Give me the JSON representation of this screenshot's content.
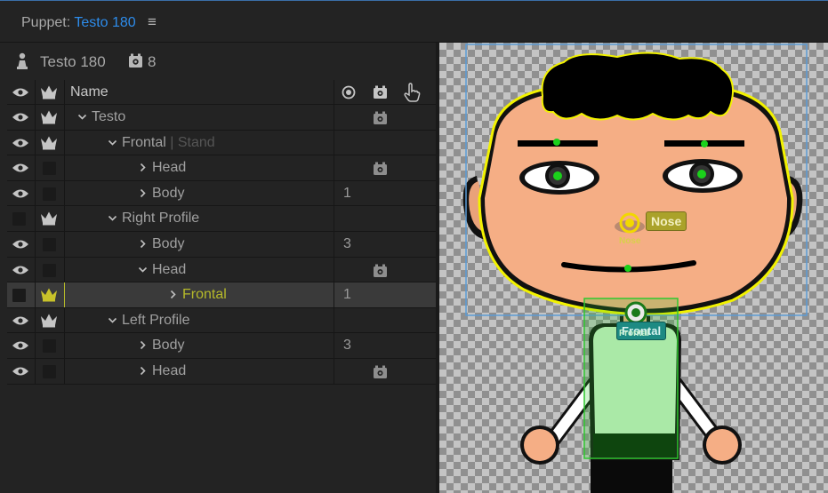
{
  "header": {
    "label": "Puppet:",
    "puppet_name": "Testo 180",
    "menu_glyph": "≡"
  },
  "puppet": {
    "name": "Testo 180",
    "behavior_count": "8"
  },
  "tree": {
    "column_name": "Name",
    "rows": [
      {
        "name": "Testo",
        "sub": "",
        "value": "",
        "eye": true,
        "crown": true,
        "behavior": true,
        "chevron": "down",
        "indent": 0,
        "selected": false
      },
      {
        "name": "Frontal",
        "sub": " | Stand",
        "value": "",
        "eye": true,
        "crown": true,
        "behavior": false,
        "chevron": "down",
        "indent": 1,
        "selected": false
      },
      {
        "name": "Head",
        "sub": "",
        "value": "",
        "eye": true,
        "crown": false,
        "behavior": true,
        "chevron": "right",
        "indent": 2,
        "selected": false
      },
      {
        "name": "Body",
        "sub": "",
        "value": "1",
        "eye": true,
        "crown": false,
        "behavior": false,
        "chevron": "right",
        "indent": 2,
        "selected": false
      },
      {
        "name": "Right Profile",
        "sub": "",
        "value": "",
        "eye": false,
        "crown": true,
        "behavior": false,
        "chevron": "down",
        "indent": 1,
        "selected": false
      },
      {
        "name": "Body",
        "sub": "",
        "value": "3",
        "eye": true,
        "crown": false,
        "behavior": false,
        "chevron": "right",
        "indent": 2,
        "selected": false
      },
      {
        "name": "Head",
        "sub": "",
        "value": "",
        "eye": true,
        "crown": false,
        "behavior": true,
        "chevron": "down",
        "indent": 2,
        "selected": false
      },
      {
        "name": "Frontal",
        "sub": "",
        "value": "1",
        "eye": false,
        "crown": true,
        "behavior": false,
        "chevron": "right",
        "indent": 3,
        "selected": true
      },
      {
        "name": "Left Profile",
        "sub": "",
        "value": "",
        "eye": true,
        "crown": true,
        "behavior": false,
        "chevron": "down",
        "indent": 1,
        "selected": false
      },
      {
        "name": "Body",
        "sub": "",
        "value": "3",
        "eye": true,
        "crown": false,
        "behavior": false,
        "chevron": "right",
        "indent": 2,
        "selected": false
      },
      {
        "name": "Head",
        "sub": "",
        "value": "",
        "eye": true,
        "crown": false,
        "behavior": true,
        "chevron": "right",
        "indent": 2,
        "selected": false
      }
    ]
  },
  "canvas": {
    "nose_tag": "Nose",
    "nose_sub": "Nose",
    "frontal_tag": "Frontal",
    "frontal_sub": "Frontal"
  },
  "colors": {
    "accent_blue": "#2d8ceb",
    "highlight_yellow": "#b5b92a",
    "selection_bg": "#3a3a3a",
    "skin": "#f5ae85",
    "shirt": "#cdf3c9"
  }
}
